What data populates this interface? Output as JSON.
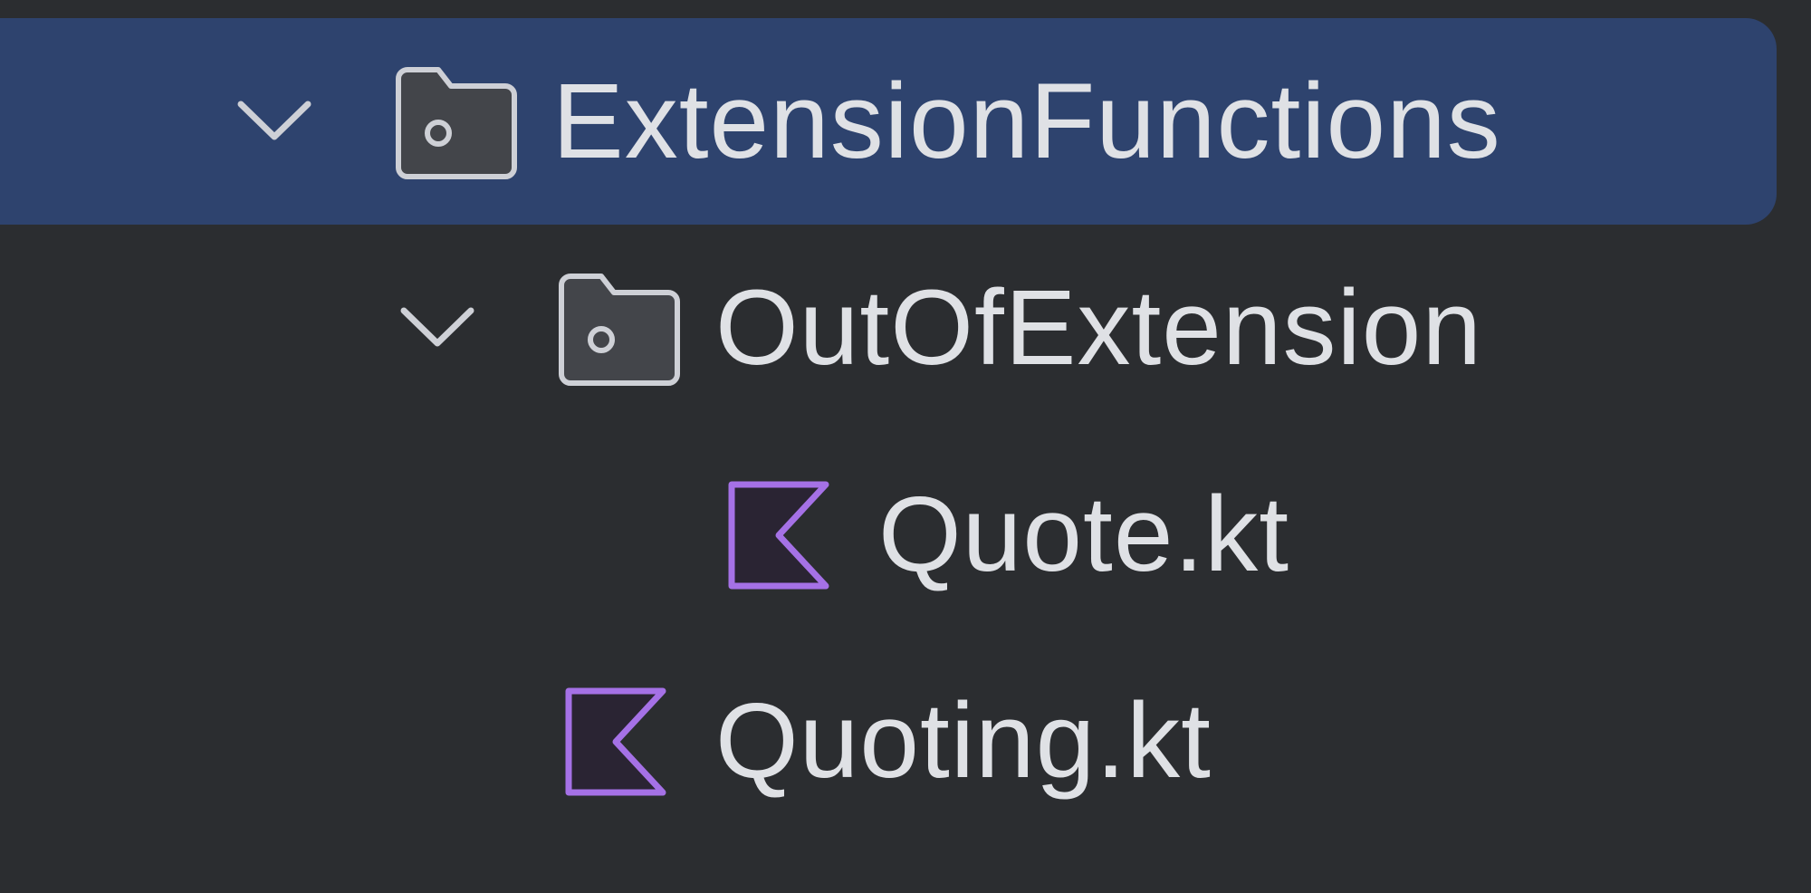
{
  "project_tree": {
    "items": [
      {
        "label": "ExtensionFunctions",
        "type": "folder",
        "icon": "folder-icon",
        "expanded": true,
        "selected": true,
        "depth": 0
      },
      {
        "label": "OutOfExtension",
        "type": "folder",
        "icon": "folder-icon",
        "expanded": true,
        "selected": false,
        "depth": 1
      },
      {
        "label": "Quote.kt",
        "type": "kotlin-file",
        "icon": "kotlin-file-icon",
        "selected": false,
        "depth": 2
      },
      {
        "label": "Quoting.kt",
        "type": "kotlin-file",
        "icon": "kotlin-file-icon",
        "selected": false,
        "depth": 1
      }
    ]
  },
  "colors": {
    "background": "#2b2d30",
    "selection": "#2e436e",
    "text": "#dfe1e5",
    "kotlin_icon": "#a571e6",
    "folder_icon_stroke": "#ced0d6",
    "folder_icon_fill": "#43454a"
  }
}
